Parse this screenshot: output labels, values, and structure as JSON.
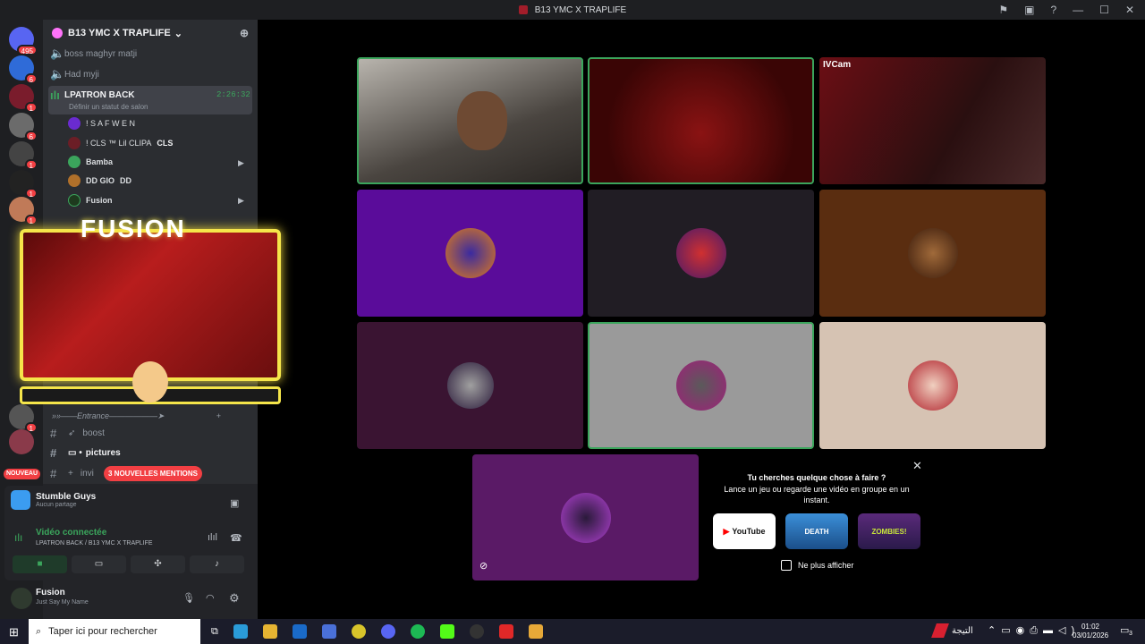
{
  "window": {
    "title": "B13 YMC X TRAPLIFE"
  },
  "guild_bar": {
    "badges": [
      "495",
      "6",
      "1",
      "6",
      "1",
      "1",
      "1",
      "1"
    ],
    "new_label": "NOUVEAU"
  },
  "sidebar": {
    "server_name": "B13 YMC X TRAPLIFE",
    "channels_top": [
      {
        "name": "boss maghyr matji"
      },
      {
        "name": "Had myji"
      }
    ],
    "active_channel": {
      "name": "LPATRON BACK",
      "timer": "2:26:32",
      "status": "Définir un statut de salon"
    },
    "voice_users": [
      {
        "name": "! S A F W E N"
      },
      {
        "name": "! CLS ™ Lil CLIPA",
        "tag": "CLS"
      },
      {
        "name": "Bamba"
      },
      {
        "name": "DD GIO",
        "tag": "DD"
      },
      {
        "name": "Fusion"
      }
    ],
    "overlay_title": "FUSION",
    "category": "»»——Entrance——————➤",
    "text_channels": [
      {
        "name": "boost"
      },
      {
        "name": "pictures"
      },
      {
        "name": "invi"
      }
    ],
    "mentions_badge": "3 NOUVELLES MENTIONS"
  },
  "activity": {
    "game": "Stumble Guys",
    "sub": "Aucun partage"
  },
  "voice_connected": {
    "label": "Vidéo connectée",
    "location": "LPATRON BACK / B13 YMC X TRAPLIFE"
  },
  "user": {
    "name": "Fusion",
    "status": "Just Say My Name"
  },
  "grid": {
    "ivcam_label": "IVCam"
  },
  "suggest": {
    "heading": "Tu cherches quelque chose à faire ?",
    "body": "Lance un jeu ou regarde une vidéo en groupe en un instant.",
    "apps": [
      "YouTube",
      "DEATH",
      "ZOMBIES!"
    ],
    "checkbox_label": "Ne plus afficher"
  },
  "taskbar": {
    "search_placeholder": "Taper ici pour rechercher",
    "tray_label": "التيجة",
    "time": "01:02",
    "date": "03/01/2026",
    "notif_count": "3"
  }
}
